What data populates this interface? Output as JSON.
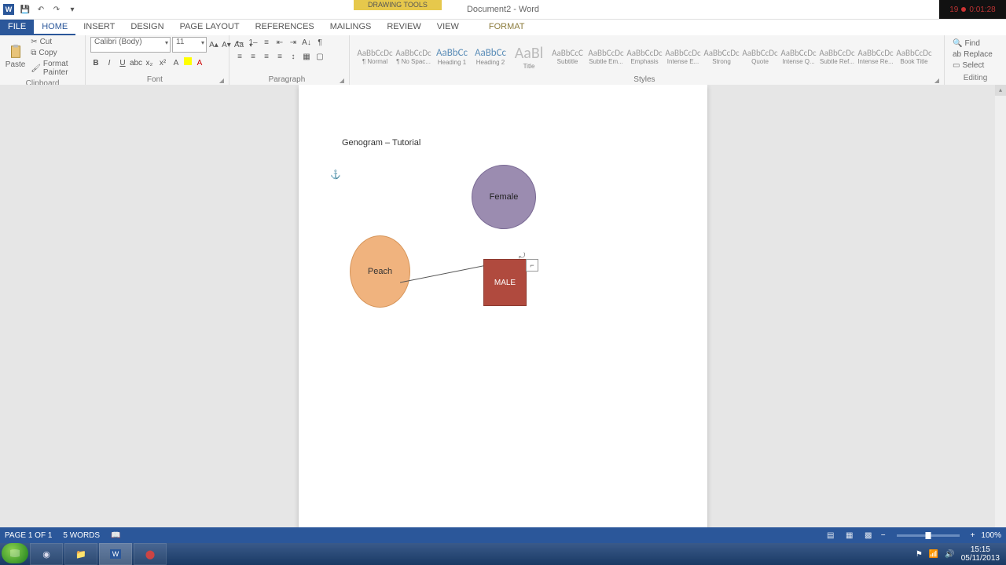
{
  "app": {
    "title": "Document2 - Word",
    "contextual_group": "DRAWING TOOLS"
  },
  "qat": {
    "save": "💾",
    "undo": "↶",
    "redo": "↷"
  },
  "tabs": {
    "file": "FILE",
    "home": "HOME",
    "insert": "INSERT",
    "design": "DESIGN",
    "page_layout": "PAGE LAYOUT",
    "references": "REFERENCES",
    "mailings": "MAILINGS",
    "review": "REVIEW",
    "view": "VIEW",
    "format": "FORMAT"
  },
  "clipboard": {
    "paste": "Paste",
    "cut": "Cut",
    "copy": "Copy",
    "format_painter": "Format Painter",
    "label": "Clipboard"
  },
  "font": {
    "name": "Calibri (Body)",
    "size": "11",
    "label": "Font"
  },
  "paragraph": {
    "label": "Paragraph"
  },
  "styles": {
    "label": "Styles",
    "items": [
      {
        "preview": "AaBbCcDc",
        "name": "¶ Normal"
      },
      {
        "preview": "AaBbCcDc",
        "name": "¶ No Spac..."
      },
      {
        "preview": "AaBbCc",
        "name": "Heading 1"
      },
      {
        "preview": "AaBbCc",
        "name": "Heading 2"
      },
      {
        "preview": "AaBl",
        "name": "Title"
      },
      {
        "preview": "AaBbCcC",
        "name": "Subtitle"
      },
      {
        "preview": "AaBbCcDc",
        "name": "Subtle Em..."
      },
      {
        "preview": "AaBbCcDc",
        "name": "Emphasis"
      },
      {
        "preview": "AaBbCcDc",
        "name": "Intense E..."
      },
      {
        "preview": "AaBbCcDc",
        "name": "Strong"
      },
      {
        "preview": "AaBbCcDc",
        "name": "Quote"
      },
      {
        "preview": "AaBbCcDc",
        "name": "Intense Q..."
      },
      {
        "preview": "AaBbCcDc",
        "name": "Subtle Ref..."
      },
      {
        "preview": "AaBbCcDc",
        "name": "Intense Re..."
      },
      {
        "preview": "AaBbCcDc",
        "name": "Book Title"
      }
    ]
  },
  "editing": {
    "find": "Find",
    "replace": "Replace",
    "select": "Select",
    "label": "Editing"
  },
  "document": {
    "heading": "Genogram – Tutorial",
    "shapes": {
      "female": "Female",
      "peach": "Peach",
      "male": "MALE"
    }
  },
  "status": {
    "page": "PAGE 1 OF 1",
    "words": "5 WORDS",
    "zoom": "100%",
    "zoom_minus": "−",
    "zoom_plus": "+"
  },
  "recorder": {
    "time": "0:01:28",
    "fps": "19"
  },
  "tray": {
    "time": "15:15",
    "date": "05/11/2013"
  }
}
